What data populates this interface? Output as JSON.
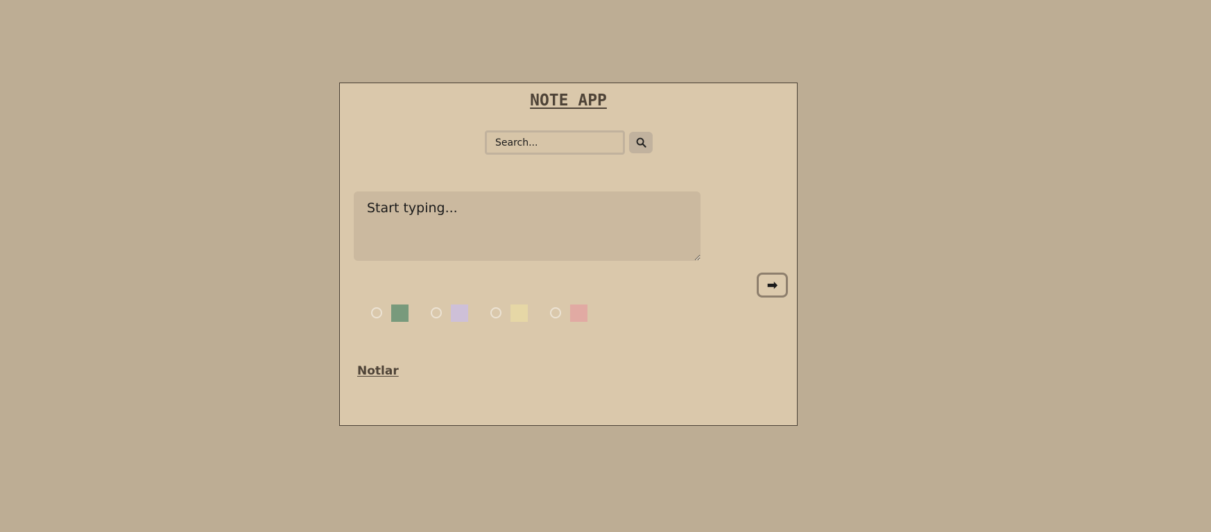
{
  "app": {
    "title": "NOTE APP"
  },
  "search": {
    "placeholder": "Search...",
    "icon": "search-icon"
  },
  "note_input": {
    "placeholder": "Start typing..."
  },
  "submit": {
    "label": "➡",
    "icon": "arrow-right-icon"
  },
  "colors": [
    {
      "name": "green",
      "hex": "#789a7c"
    },
    {
      "name": "lavender",
      "hex": "#cec0d8"
    },
    {
      "name": "yellow",
      "hex": "#e6d7a6"
    },
    {
      "name": "pink",
      "hex": "#e1aaa3"
    }
  ],
  "notes": {
    "heading": "Notlar"
  }
}
